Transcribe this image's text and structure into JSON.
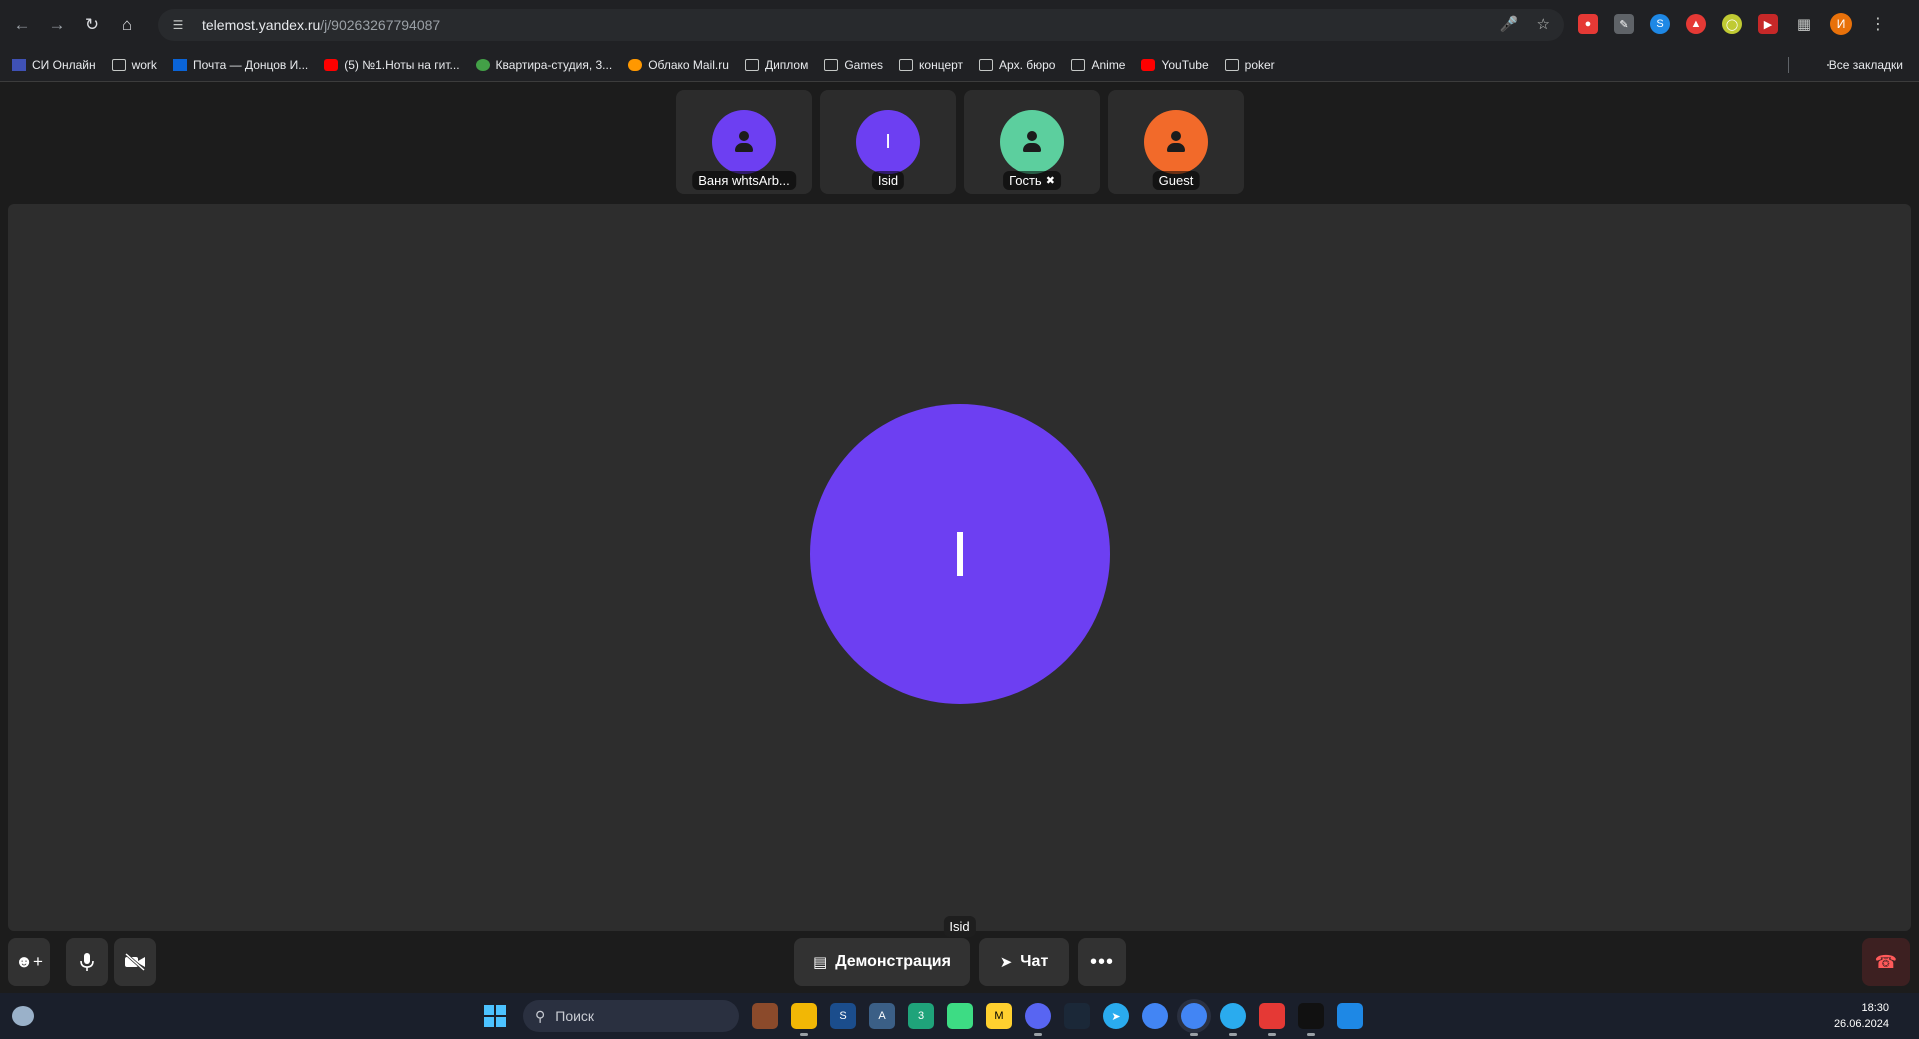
{
  "browser": {
    "url_host": "telemost.yandex.ru",
    "url_path": "/j/90263267794087",
    "profile_initial": "И",
    "bookmarks": [
      {
        "label": "СИ Онлайн",
        "icon": "si-icon"
      },
      {
        "label": "work",
        "icon": "folder-icon"
      },
      {
        "label": "Почта — Донцов И...",
        "icon": "outlook-icon"
      },
      {
        "label": "(5) №1.Ноты на гит...",
        "icon": "youtube-icon"
      },
      {
        "label": "Квартира-студия, 3...",
        "icon": "avito-icon"
      },
      {
        "label": "Облако Mail.ru",
        "icon": "cloud-icon"
      },
      {
        "label": "Диплом",
        "icon": "folder-icon"
      },
      {
        "label": "Games",
        "icon": "folder-icon"
      },
      {
        "label": "концерт",
        "icon": "folder-icon"
      },
      {
        "label": "Арх. бюро",
        "icon": "folder-icon"
      },
      {
        "label": "Anime",
        "icon": "folder-icon"
      },
      {
        "label": "YouTube",
        "icon": "youtube-icon"
      },
      {
        "label": "poker",
        "icon": "folder-icon"
      }
    ],
    "all_bookmarks_label": "Все закладки"
  },
  "meeting": {
    "participants": [
      {
        "name": "Ваня whtsArb...",
        "avatar_color": "#6d3ff2",
        "initial": "",
        "muted": false
      },
      {
        "name": "Isid",
        "avatar_color": "#6d3ff2",
        "initial": "I",
        "muted": false
      },
      {
        "name": "Гость",
        "avatar_color": "#5ccf9e",
        "initial": "",
        "muted": true
      },
      {
        "name": "Guest",
        "avatar_color": "#f26a2a",
        "initial": "",
        "muted": false
      }
    ],
    "active_speaker": {
      "name": "Isid",
      "initial": "I",
      "color": "#6d3ff2"
    },
    "controls": {
      "screen_share_label": "Демонстрация",
      "chat_label": "Чат"
    }
  },
  "taskbar": {
    "search_placeholder": "Поиск",
    "time": "18:30",
    "date": "26.06.2024"
  }
}
